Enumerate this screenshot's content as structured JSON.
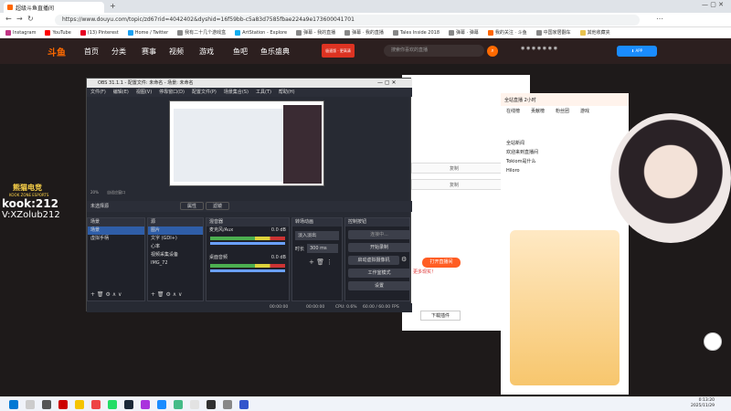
{
  "browser": {
    "tab_title": "超级斗鱼直播间",
    "url": "https://www.douyu.com/topic/zd67rid=4042402&dyshid=16f59bb-c5a83d7585fbae224a9e173600041701",
    "bookmarks": [
      "Instagram",
      "YouTube",
      "(13) Pinterest",
      "Home / Twitter",
      "我有二十几个游戏盒",
      "ArtStation - Explore",
      "弹幕 - 我的直播",
      "弹幕 · 我的直播",
      "Tales Inside 2018",
      "弹幕 · 弹幕",
      "我的关注 · 斗鱼",
      "中国家居翻车",
      "其他收藏夹"
    ]
  },
  "site": {
    "logo": "斗鱼",
    "nav": [
      "首页",
      "分类",
      "赛事",
      "视频",
      "游戏",
      "鱼吧",
      "鱼乐盛典"
    ],
    "search_placeholder": "搜索你喜欢的直播",
    "promo_banner": "极速版 · 更高清",
    "side_text": {
      "brand": "熊猫电竞",
      "brand_en": "KOOK ZONE ESPORTS",
      "kook": "kook:212",
      "wx": "V:XZolub212"
    },
    "buttons": {
      "live": "打开直播间",
      "download": "下载插件"
    },
    "panel_text": {
      "dialog": "更多现实！",
      "copy1": "复制",
      "copy2": "复制",
      "copy3": "复制"
    }
  },
  "obs": {
    "title": "OBS 31.1.1 - 配置文件: 未命名 - 场景: 未命名",
    "menu": [
      "文件(F)",
      "编辑(E)",
      "视图(V)",
      "停靠窗口(D)",
      "配置文件(P)",
      "场景集合(S)",
      "工具(T)",
      "帮助(H)"
    ],
    "zoom": "20%",
    "zoom_label": "自适应窗口",
    "source_bar": {
      "none": "未选择源",
      "props": "属性",
      "filters": "滤镜"
    },
    "docks": {
      "scenes": {
        "title": "场景",
        "items": [
          "场景",
          "虚拟手柄"
        ]
      },
      "sources": {
        "title": "源",
        "items": [
          "图片",
          "文字 (GDI+)",
          "心率",
          "视频采集设备",
          "IMG_72"
        ]
      },
      "mixer": {
        "title": "混音器",
        "channels": [
          {
            "name": "麦克风/Aux",
            "level": "0.0 dB"
          },
          {
            "name": "桌面音频",
            "level": "0.0 dB"
          }
        ]
      },
      "transitions": {
        "title": "转场动画",
        "type": "淡入淡出",
        "duration_label": "时长",
        "duration": "300 ms"
      },
      "controls": {
        "title": "控制按钮",
        "buttons": [
          "连接中...",
          "开始录制",
          "启动虚拟摄像机",
          "工作室模式",
          "设置"
        ]
      }
    },
    "status": {
      "rec": "00:00:00",
      "stream": "00:00:00",
      "cpu": "CPU: 0.6%",
      "fps": "60.00 / 60.00 FPS"
    }
  },
  "chat": {
    "header": "全站直播 2小时",
    "tabs": [
      "在线榜",
      "贡献榜",
      "粉丝团",
      "游戏"
    ],
    "items": [
      "全站新闻",
      "欢迎来到直播间",
      "Tokiom是什么",
      "Hiloro"
    ]
  },
  "taskbar": {
    "time": "0:13:20",
    "date": "2025/11/29"
  }
}
